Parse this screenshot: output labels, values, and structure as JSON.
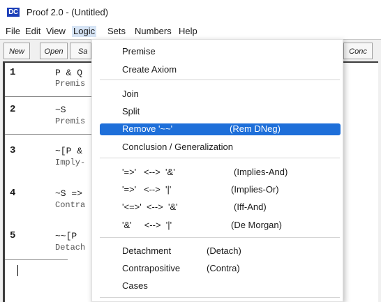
{
  "window": {
    "app_icon": "DC",
    "title": "Proof 2.0 - (Untitled)"
  },
  "menubar": [
    "File",
    "Edit",
    "View",
    "Logic",
    "Sets",
    "Numbers",
    "Help"
  ],
  "toolbar": {
    "new": "New",
    "open": "Open",
    "save_partial": "Sa",
    "conc": "Conc"
  },
  "proof": [
    {
      "num": "1",
      "text": "P & Q",
      "reason": "Premis"
    },
    {
      "num": "2",
      "text": "~S",
      "reason": "Premis"
    },
    {
      "num": "3",
      "text": "~[P &",
      "reason": "Imply-"
    },
    {
      "num": "4",
      "text": "~S =>",
      "reason": "Contra"
    },
    {
      "num": "5",
      "text": "~~[P",
      "reason": "Detach"
    }
  ],
  "logic_menu": {
    "premise": "Premise",
    "create_axiom": "Create Axiom",
    "join": "Join",
    "split": "Split",
    "remove_dneg": {
      "label": "Remove '~~'",
      "short": "(Rem DNeg)"
    },
    "conclusion": "Conclusion / Generalization",
    "implies_and": {
      "label": "'=>'   <-->  '&'",
      "short": "(Implies-And)"
    },
    "implies_or": {
      "label": "'=>'   <-->  '|'",
      "short": "(Implies-Or)"
    },
    "iff_and": {
      "label": "'<=>'  <-->  '&'",
      "short": "(Iff-And)"
    },
    "de_morgan": {
      "label": "'&'     <-->  '|'",
      "short": "(De Morgan)"
    },
    "detachment": {
      "label": "Detachment",
      "short": "(Detach)"
    },
    "contrapositive": {
      "label": "Contrapositive",
      "short": "(Contra)"
    },
    "cases": "Cases"
  },
  "colors": {
    "highlight": "#1e6fd9",
    "icon_bg": "#1c3fb8"
  }
}
